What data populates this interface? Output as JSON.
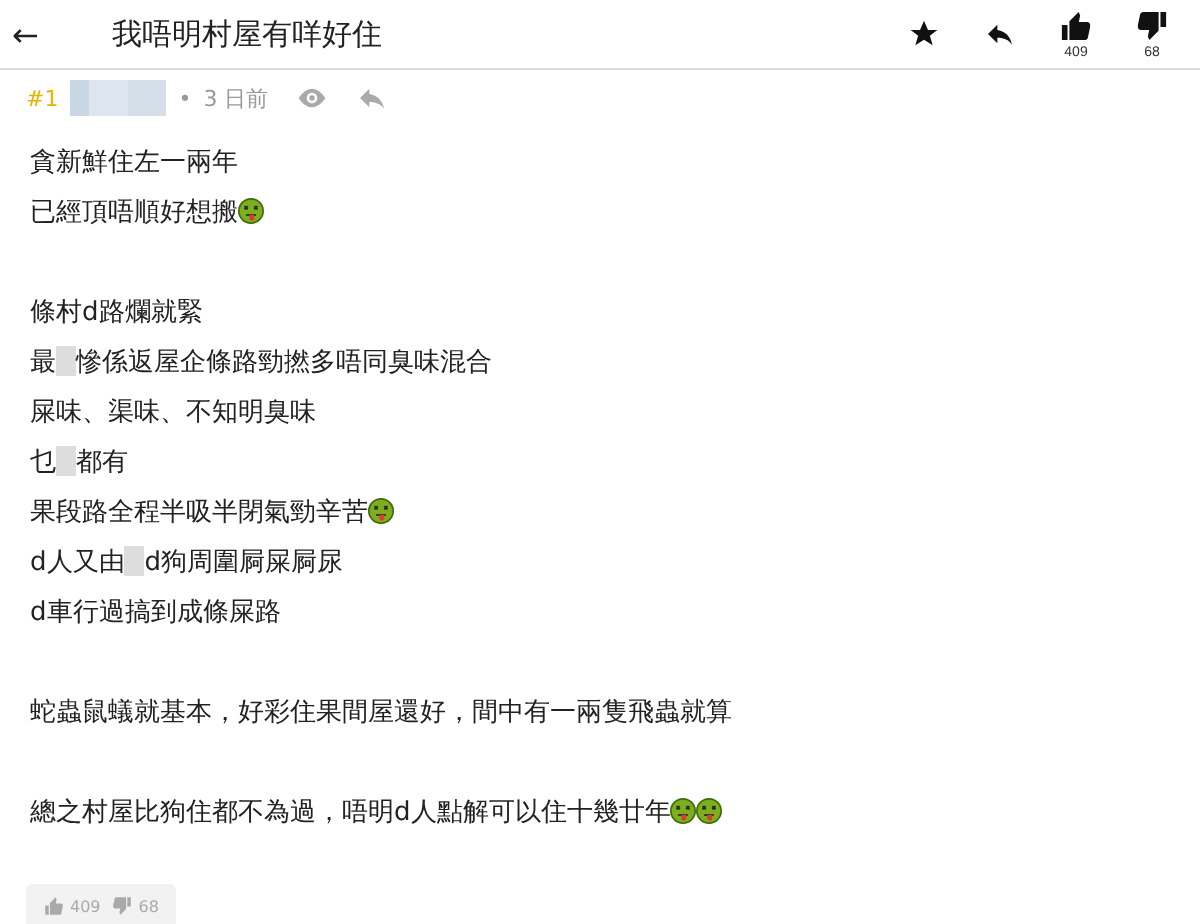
{
  "header": {
    "back": "←",
    "title": "我唔明村屋有咩好住",
    "likes": "409",
    "dislikes": "68"
  },
  "post": {
    "number": "#1",
    "author": {
      "kind": "redacted"
    },
    "separator": "•",
    "time": "3 日前",
    "paragraphs": [
      [
        [
          {
            "kind": "text",
            "text": "貪新鮮住左一兩年"
          }
        ],
        [
          {
            "kind": "text",
            "text": "已經頂唔順好想搬"
          },
          {
            "kind": "emoji"
          }
        ]
      ],
      [
        [
          {
            "kind": "text",
            "text": "條村d路爛就緊"
          }
        ],
        [
          {
            "kind": "text",
            "text": "最"
          },
          {
            "kind": "redacted"
          },
          {
            "kind": "text",
            "text": "慘係返屋企條路勁撚多唔同臭味混合"
          }
        ],
        [
          {
            "kind": "text",
            "text": "屎味、渠味、不知明臭味"
          }
        ],
        [
          {
            "kind": "text",
            "text": "乜"
          },
          {
            "kind": "redacted"
          },
          {
            "kind": "text",
            "text": "都有"
          }
        ],
        [
          {
            "kind": "text",
            "text": "果段路全程半吸半閉氣勁辛苦"
          },
          {
            "kind": "emoji"
          }
        ],
        [
          {
            "kind": "text",
            "text": "d人又由"
          },
          {
            "kind": "redacted"
          },
          {
            "kind": "text",
            "text": "d狗周圍屙屎屙尿"
          }
        ],
        [
          {
            "kind": "text",
            "text": "d車行過搞到成條屎路"
          }
        ]
      ],
      [
        [
          {
            "kind": "text",
            "text": "蛇蟲鼠蟻就基本，好彩住果間屋還好，間中有一兩隻飛蟲就算"
          }
        ]
      ],
      [
        [
          {
            "kind": "text",
            "text": "總之村屋比狗住都不為過，唔明d人點解可以住十幾廿年"
          },
          {
            "kind": "emoji"
          },
          {
            "kind": "emoji"
          }
        ]
      ]
    ],
    "likes": "409",
    "dislikes": "68"
  }
}
